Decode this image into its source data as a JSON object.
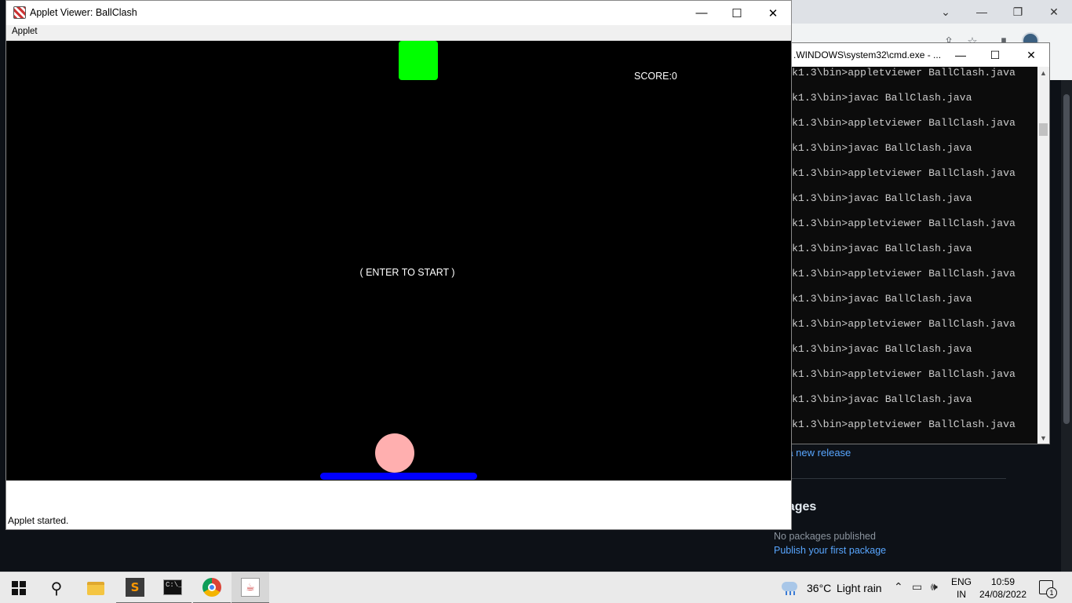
{
  "applet_window": {
    "title": "Applet Viewer: BallClash",
    "menu": [
      "Applet"
    ],
    "controls": {
      "minimize": "—",
      "maximize": "☐",
      "close": "✕"
    },
    "status": "Applet started."
  },
  "game": {
    "score_text": "SCORE:0",
    "start_text": "( ENTER TO START )",
    "colors": {
      "background": "#000000",
      "target_block": "#00ff00",
      "ball": "#ffafaf",
      "paddle": "#0000ff"
    }
  },
  "cmd_window": {
    "title": ".WINDOWS\\system32\\cmd.exe - ...",
    "lines": [
      "k1.3\\bin>appletviewer BallClash.java",
      "k1.3\\bin>javac BallClash.java",
      "k1.3\\bin>appletviewer BallClash.java",
      "k1.3\\bin>javac BallClash.java",
      "k1.3\\bin>appletviewer BallClash.java",
      "k1.3\\bin>javac BallClash.java",
      "k1.3\\bin>appletviewer BallClash.java",
      "k1.3\\bin>javac BallClash.java",
      "k1.3\\bin>appletviewer BallClash.java",
      "k1.3\\bin>javac BallClash.java",
      "k1.3\\bin>appletviewer BallClash.java",
      "k1.3\\bin>javac BallClash.java",
      "k1.3\\bin>appletviewer BallClash.java",
      "k1.3\\bin>javac BallClash.java",
      "k1.3\\bin>appletviewer BallClash.java"
    ]
  },
  "browser_page": {
    "release_link": "ite a new release",
    "packages_heading": "ckages",
    "no_packages": "No packages published",
    "publish_link": "Publish your first package"
  },
  "taskbar": {
    "weather_temp": "36°C",
    "weather_desc": "Light rain",
    "lang_line1": "ENG",
    "lang_line2": "IN",
    "time": "10:59",
    "date": "24/08/2022",
    "notification_count": "1",
    "apps": [
      "start-icon",
      "search-icon",
      "file-explorer-icon",
      "sublime-text-icon",
      "cmd-icon",
      "chrome-icon",
      "java-icon"
    ]
  }
}
